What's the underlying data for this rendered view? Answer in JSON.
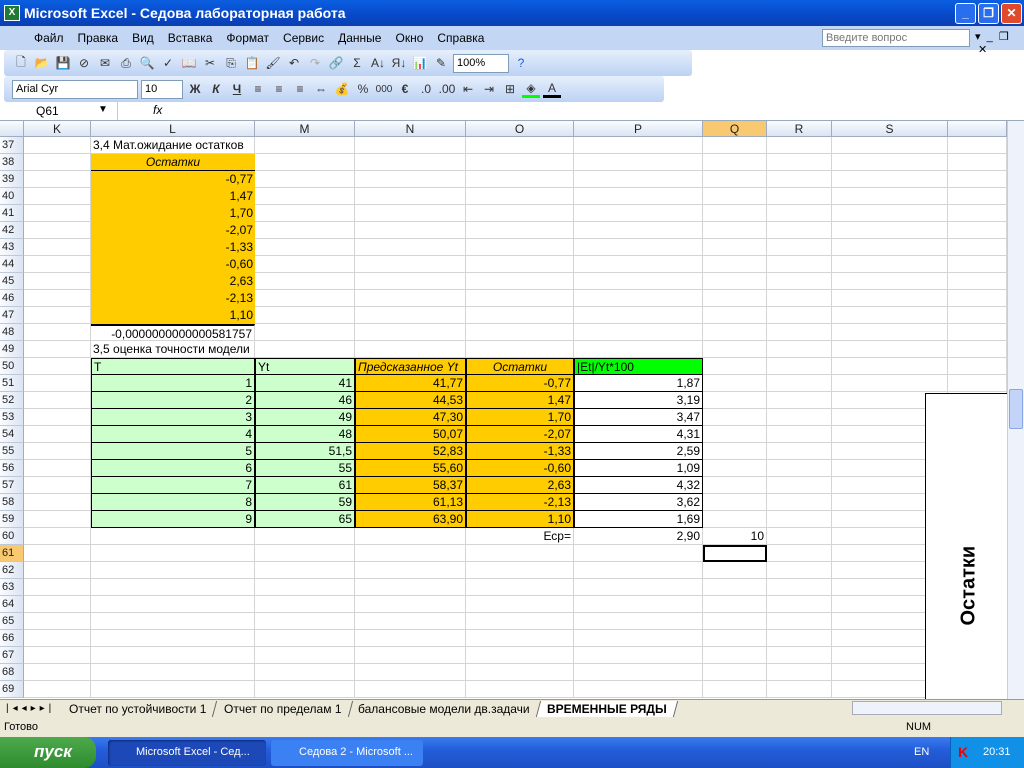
{
  "window": {
    "title": "Microsoft Excel - Седова лабораторная работа",
    "app_icon": "excel-icon"
  },
  "menu": [
    "Файл",
    "Правка",
    "Вид",
    "Вставка",
    "Формат",
    "Сервис",
    "Данные",
    "Окно",
    "Справка"
  ],
  "help_placeholder": "Введите вопрос",
  "toolbar": {
    "zoom": "100%",
    "font": "Arial Cyr",
    "size": "10",
    "bold": "Ж",
    "italic": "К",
    "underline": "Ч",
    "percent": "%",
    "thousands": "000",
    "euro": "€",
    "sigma": "Σ"
  },
  "formula": {
    "name_box": "Q61",
    "fx": "fx",
    "value": ""
  },
  "columns": [
    "K",
    "L",
    "M",
    "N",
    "O",
    "P",
    "Q",
    "R",
    "S",
    ""
  ],
  "rows": [
    37,
    38,
    39,
    40,
    41,
    42,
    43,
    44,
    45,
    46,
    47,
    48,
    49,
    50,
    51,
    52,
    53,
    54,
    55,
    56,
    57,
    58,
    59,
    60,
    61,
    62,
    63,
    64,
    65,
    66,
    67,
    68,
    69
  ],
  "section1": {
    "title": "3,4 Мат.ожидание остатков",
    "header": "Остатки",
    "values": [
      "-0,77",
      "1,47",
      "1,70",
      "-2,07",
      "-1,33",
      "-0,60",
      "2,63",
      "-2,13",
      "1,10"
    ],
    "sum": "-0,0000000000000581757"
  },
  "section2": {
    "title": "3,5 оценка точности модели",
    "headers": [
      "T",
      "Yt",
      "Предсказанное Yt",
      "Остатки",
      "|Et|/Yt*100"
    ],
    "data": [
      [
        "1",
        "41",
        "41,77",
        "-0,77",
        "1,87"
      ],
      [
        "2",
        "46",
        "44,53",
        "1,47",
        "3,19"
      ],
      [
        "3",
        "49",
        "47,30",
        "1,70",
        "3,47"
      ],
      [
        "4",
        "48",
        "50,07",
        "-2,07",
        "4,31"
      ],
      [
        "5",
        "51,5",
        "52,83",
        "-1,33",
        "2,59"
      ],
      [
        "6",
        "55",
        "55,60",
        "-0,60",
        "1,09"
      ],
      [
        "7",
        "61",
        "58,37",
        "2,63",
        "4,32"
      ],
      [
        "8",
        "59",
        "61,13",
        "-2,13",
        "3,62"
      ],
      [
        "9",
        "65",
        "63,90",
        "1,10",
        "1,69"
      ]
    ],
    "avg_label": "Еср=",
    "avg_value": "2,90",
    "q_value": "10"
  },
  "chart": {
    "title": "Остатки"
  },
  "sheets": [
    "Отчет по устойчивости 1",
    "Отчет по пределам 1",
    "балансовые модели дв.задачи",
    "ВРЕМЕННЫЕ РЯДЫ"
  ],
  "status": {
    "ready": "Готово",
    "num": "NUM"
  },
  "taskbar": {
    "start": "пуск",
    "tasks": [
      "Microsoft Excel - Сед...",
      "Седова 2 - Microsoft ..."
    ],
    "lang": "EN",
    "time": "20:31"
  },
  "colors": {
    "orange": "#FFCC00",
    "lightgreen": "#CCFFCC",
    "green": "#00FF00"
  }
}
